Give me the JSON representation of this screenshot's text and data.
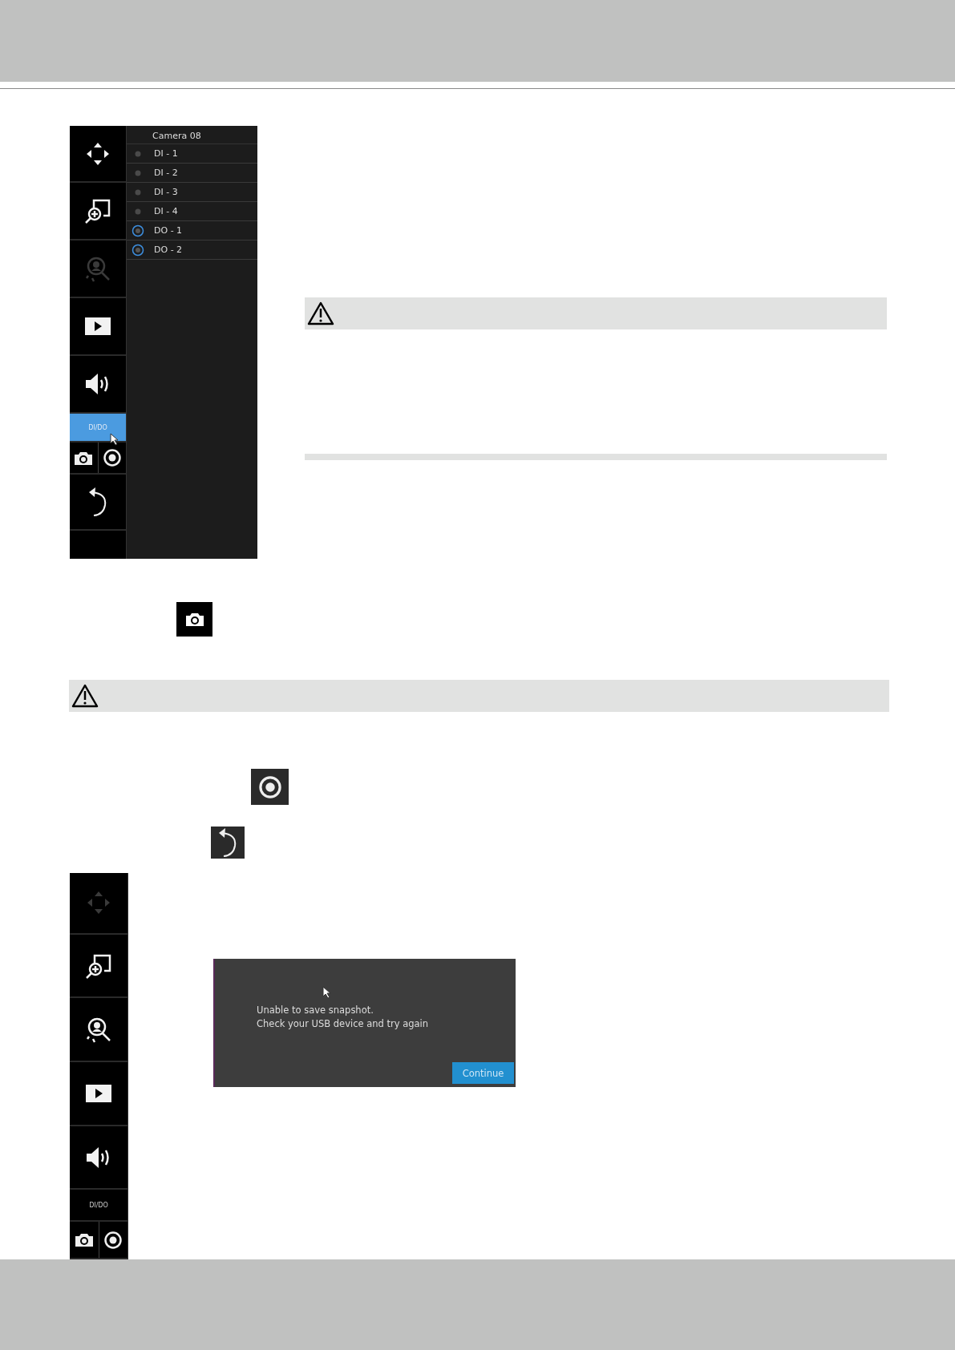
{
  "live_panel": {
    "tools": [
      {
        "kind": "pan",
        "disabled": false
      },
      {
        "kind": "zoom",
        "disabled": false
      },
      {
        "kind": "search",
        "disabled": true
      },
      {
        "kind": "play",
        "disabled": false
      },
      {
        "kind": "volume",
        "disabled": false
      },
      {
        "kind": "dido",
        "label": "DI/DO",
        "selected": true
      },
      {
        "kind": "capture",
        "disabled": false
      },
      {
        "kind": "back",
        "disabled": false
      }
    ],
    "camera_list": {
      "title": "Camera 08",
      "ports": [
        {
          "label": "DI - 1",
          "kind": "input"
        },
        {
          "label": "DI - 2",
          "kind": "input"
        },
        {
          "label": "DI - 3",
          "kind": "input"
        },
        {
          "label": "DI - 4",
          "kind": "input"
        },
        {
          "label": "DO - 1",
          "kind": "output"
        },
        {
          "label": "DO - 2",
          "kind": "output"
        }
      ]
    }
  },
  "error_panel": {
    "tools": [
      {
        "kind": "pan",
        "disabled": true
      },
      {
        "kind": "zoom",
        "disabled": false
      },
      {
        "kind": "search",
        "disabled": false
      },
      {
        "kind": "play",
        "disabled": false
      },
      {
        "kind": "volume",
        "disabled": false
      },
      {
        "kind": "dido",
        "label": "DI/DO",
        "selected": false
      },
      {
        "kind": "capture",
        "disabled": false
      }
    ],
    "dialog": {
      "message": [
        "Unable to save snapshot.",
        "Check your USB device and try again"
      ],
      "button": "Continue"
    }
  }
}
